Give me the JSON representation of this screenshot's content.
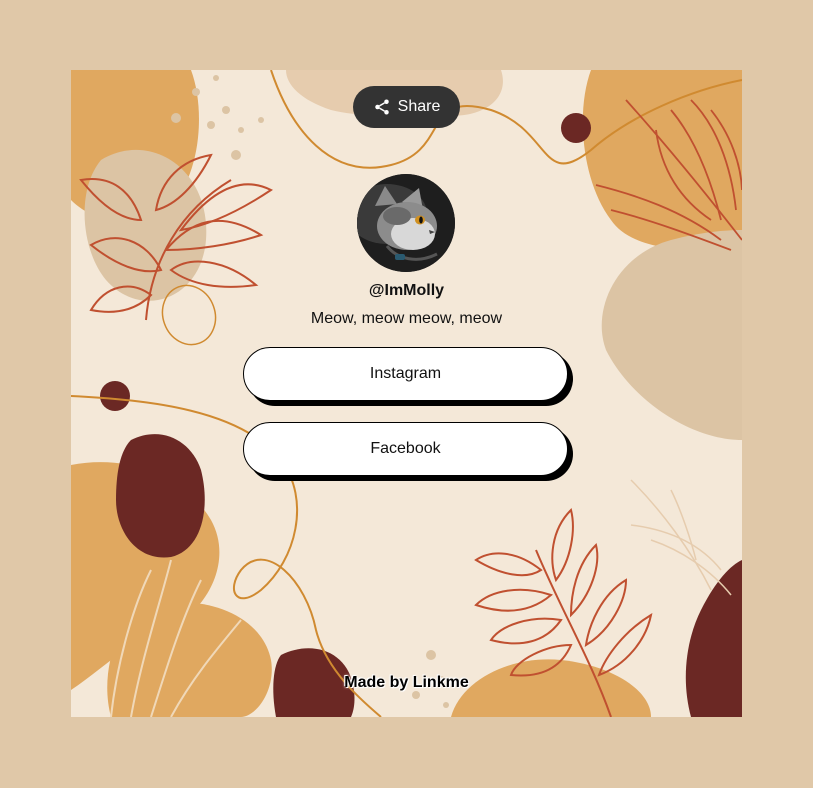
{
  "share": {
    "label": "Share",
    "icon": "share-icon"
  },
  "profile": {
    "username": "@ImMolly",
    "bio": "Meow, meow meow, meow"
  },
  "links": [
    {
      "label": "Instagram"
    },
    {
      "label": "Facebook"
    }
  ],
  "footer": {
    "text": "Made by Linkme"
  },
  "colors": {
    "page_bg": "#e0c8a8",
    "card_bg": "#f4e8d8",
    "orange": "#e0a860",
    "tan": "#dcc4a4",
    "maroon": "#6b2824",
    "rust": "#c05030",
    "line": "#d08a30"
  }
}
